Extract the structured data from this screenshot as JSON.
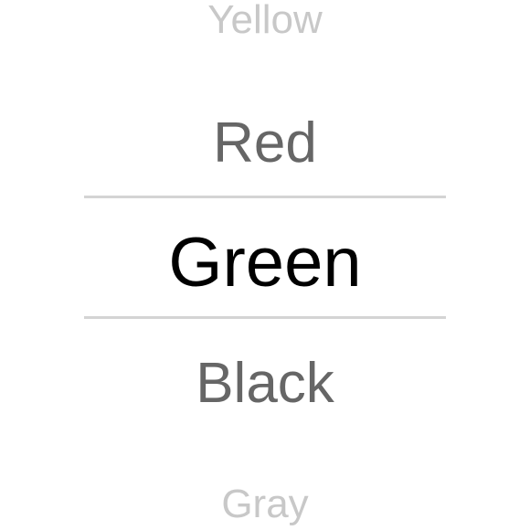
{
  "picker": {
    "items": [
      {
        "label": "Yellow",
        "state": "far"
      },
      {
        "label": "Red",
        "state": "near"
      },
      {
        "label": "Green",
        "state": "selected"
      },
      {
        "label": "Black",
        "state": "near"
      },
      {
        "label": "Gray",
        "state": "far"
      }
    ],
    "selected_value": "Green",
    "colors": {
      "selected_text": "#000000",
      "near_text": "#666666",
      "far_text": "#c8c8c8",
      "divider": "#d4d4d4"
    }
  }
}
